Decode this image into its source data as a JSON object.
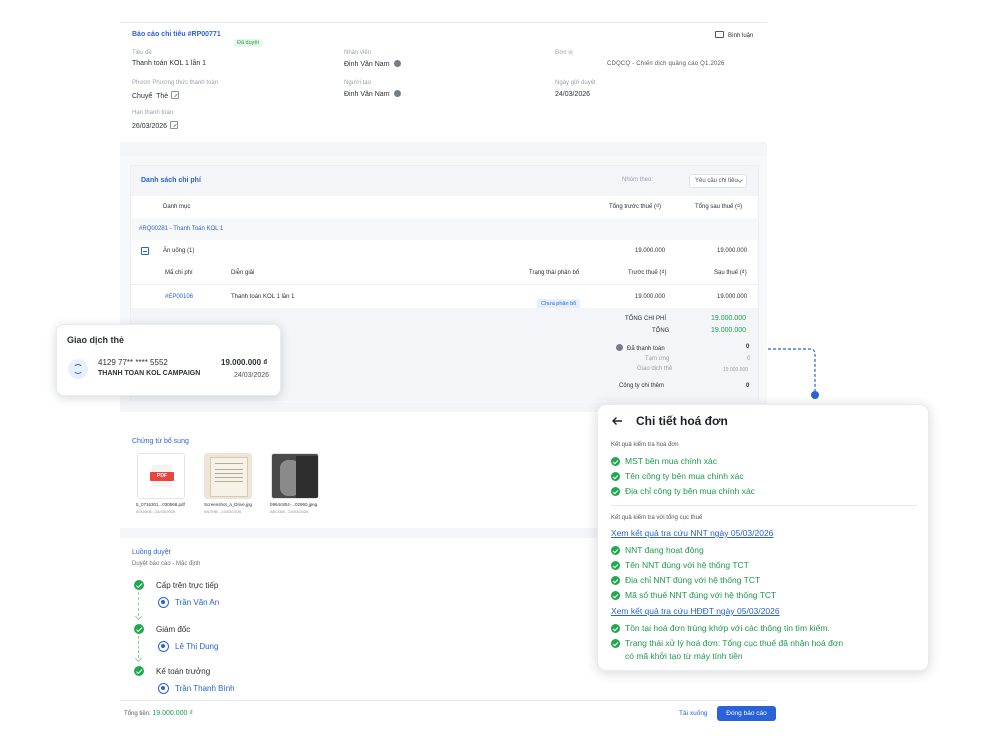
{
  "report": {
    "title": "Báo cáo chi tiêu #RP00771",
    "status": "Đã duyệt",
    "comment_label": "Bình luận",
    "fields": {
      "subject_label": "Tiêu đề",
      "subject": "Thanh toán KOL 1 lần 1",
      "employee_label": "Nhân viên",
      "employee": "Đinh Văn Nam",
      "unit_label": "Đơn vị",
      "unit": "CDQCQ - Chiến dịch quảng cáo Q1.2026",
      "method_prefix": "Phươn",
      "method_label": "Phương thức thanh toán",
      "method_prefix2": "Chuyể",
      "method": "Thẻ",
      "creator_label": "Người tạo",
      "creator": "Đinh Văn Nam",
      "sent_date_label": "Ngày gửi duyệt",
      "sent_date": "24/03/2026",
      "due_label": "Hạn thanh toán",
      "due": "26/03/2026"
    }
  },
  "expenses": {
    "title": "Danh sách chi phí",
    "group_by_label": "Nhóm theo:",
    "group_by_value": "Yêu cầu chi tiêu",
    "headers": {
      "category": "Danh mục",
      "pre_tax": "Tổng trước thuế (₫)",
      "post_tax": "Tổng sau thuế (₫)"
    },
    "request": "#RQ00281 - Thanh Toán KOL 1",
    "group": {
      "name": "Ăn uống (1)",
      "pre_tax": "19.000.000",
      "post_tax": "19.000.000"
    },
    "sub_headers": {
      "code": "Mã chi phí",
      "desc": "Diễn giải",
      "alloc": "Trạng thái phân bổ",
      "pre": "Trước thuế (₫)",
      "post": "Sau thuế (₫)"
    },
    "item": {
      "code": "#EP00106",
      "desc": "Thanh toán KOL 1 lần 1",
      "alloc": "Chưa phân bổ",
      "pre": "19.000.000",
      "post": "19.000.000"
    },
    "totals": {
      "total_cost_label": "TỔNG CHI PHÍ",
      "total_cost": "19.000.000",
      "total_label": "TỔNG",
      "total": "19.000.000",
      "paid_label": "Đã thanh toán",
      "paid": "0",
      "advance_label": "Tạm ứng",
      "advance": "0",
      "txn_label": "Giao dịch thẻ",
      "txn": "19.000.000",
      "company_label": "Công ty chi thêm",
      "company": "0"
    }
  },
  "transaction_card": {
    "title": "Giao dịch thẻ",
    "card_number": "4129 77** **** 5552",
    "amount": "19.000.000 ₫",
    "merchant": "THANH TOAN KOL CAMPAIGN",
    "date": "24/03/2026"
  },
  "attachments": {
    "title": "Chứng từ bổ sung",
    "files": [
      {
        "name": "5_0716301...030568.pdf",
        "meta": "AYLNKB - 24/03/2026",
        "icon": "pdf-icon"
      },
      {
        "name": "Screenshot_a_Drive.jpg",
        "meta": "WLTHB - 24/03/2026",
        "icon": "image-icon"
      },
      {
        "name": "b964c804-...02960.jpeg",
        "meta": "AELTAB - 24/03/2026",
        "icon": "image-icon"
      }
    ]
  },
  "flow": {
    "title": "Luồng duyệt",
    "subtitle": "Duyệt báo cáo - Mặc định",
    "steps": [
      {
        "role": "Cấp trên trực tiếp",
        "person": "Trần Văn An"
      },
      {
        "role": "Giám đốc",
        "person": "Lê Thị Dung"
      },
      {
        "role": "Kế toán trưởng",
        "person": "Trần Thanh Bình"
      }
    ]
  },
  "footer": {
    "total_label": "Tổng tiền:",
    "total_value": "19.000.000 ₫",
    "download": "Tải xuống",
    "close": "Đóng báo cáo"
  },
  "invoice": {
    "title": "Chi tiết hoá đơn",
    "section1": "Kết quả kiểm tra hoá đơn",
    "checks1": [
      "MST bên mua chính xác",
      "Tên công ty bên mua chính xác",
      "Địa chỉ công ty bên mua chính xác"
    ],
    "section2": "Kết quả kiểm tra với tổng cục thuế",
    "link1": "Xem kết quả tra cứu NNT ngày 05/03/2026",
    "checks2": [
      "NNT đang hoạt động",
      "Tên NNT đúng với hệ thống TCT",
      "Địa chỉ NNT đúng với hệ thống TCT",
      "Mã số thuế NNT đúng với hệ thống TCT"
    ],
    "link2": "Xem kết quả tra cứu HĐĐT ngày 05/03/2026",
    "checks3": [
      "Tồn tại hoá đơn trùng khớp với các thông tin tìm kiếm."
    ],
    "check4_line1": "Trạng thái xử lý hoá đơn: Tổng cục thuế đã nhận hoá đơn",
    "check4_line2": "có mã khởi tạo từ máy tính tiền"
  },
  "colors": {
    "accent": "#2a62d8",
    "success": "#1fa84f"
  }
}
